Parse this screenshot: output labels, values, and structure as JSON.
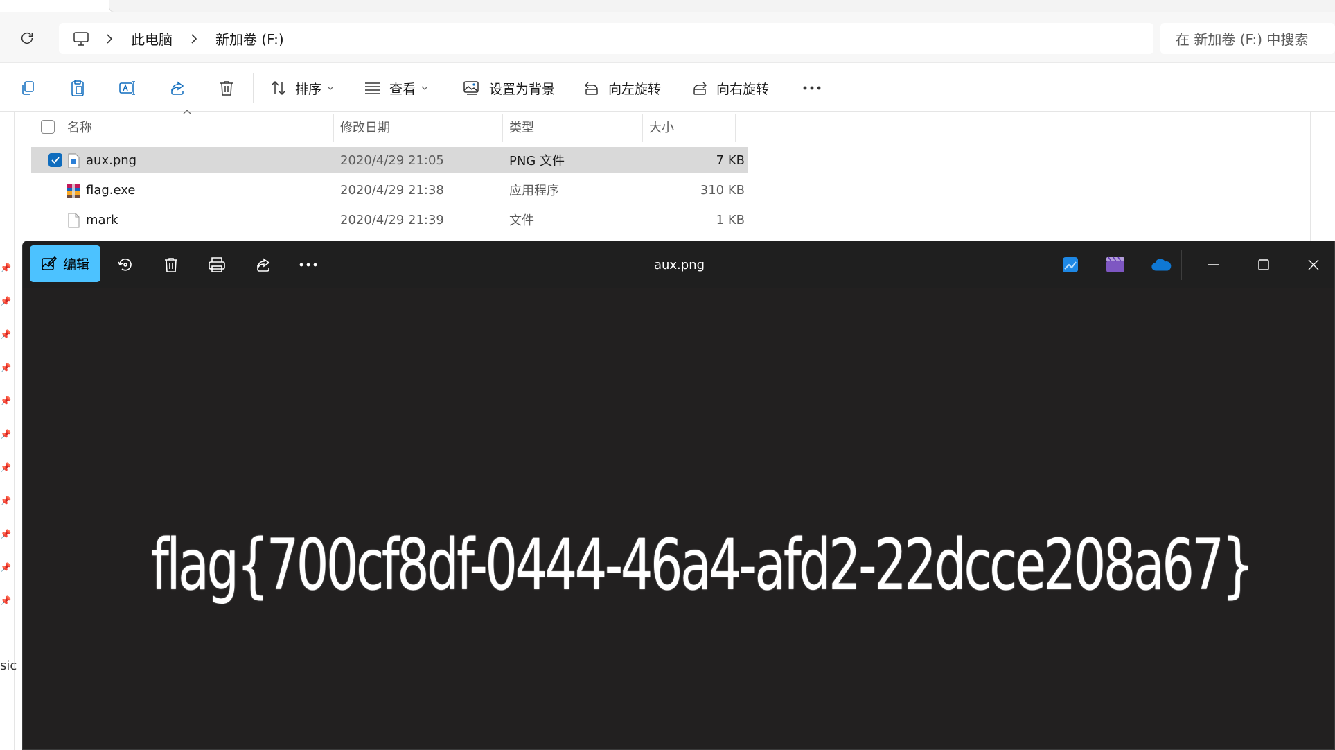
{
  "explorer": {
    "breadcrumb": [
      "此电脑",
      "新加卷 (F:)"
    ],
    "search_placeholder": "在 新加卷 (F:) 中搜索",
    "toolbar": {
      "sort_label": "排序",
      "view_label": "查看",
      "set_background_label": "设置为背景",
      "rotate_left_label": "向左旋转",
      "rotate_right_label": "向右旋转"
    },
    "columns": {
      "name": "名称",
      "modified": "修改日期",
      "type": "类型",
      "size": "大小"
    },
    "files": [
      {
        "name": "aux.png",
        "modified": "2020/4/29 21:05",
        "type": "PNG 文件",
        "size": "7 KB",
        "selected": true,
        "icon": "image-file-icon"
      },
      {
        "name": "flag.exe",
        "modified": "2020/4/29 21:38",
        "type": "应用程序",
        "size": "310 KB",
        "selected": false,
        "icon": "executable-file-icon"
      },
      {
        "name": "mark",
        "modified": "2020/4/29 21:39",
        "type": "文件",
        "size": "1 KB",
        "selected": false,
        "icon": "generic-file-icon"
      }
    ],
    "left_edge_fragment": "sic"
  },
  "viewer": {
    "title": "aux.png",
    "edit_label": "编辑",
    "image_text": "flag{700cf8df-0444-46a4-afd2-22dcce208a67}",
    "accent_color": "#4cc2ff"
  }
}
